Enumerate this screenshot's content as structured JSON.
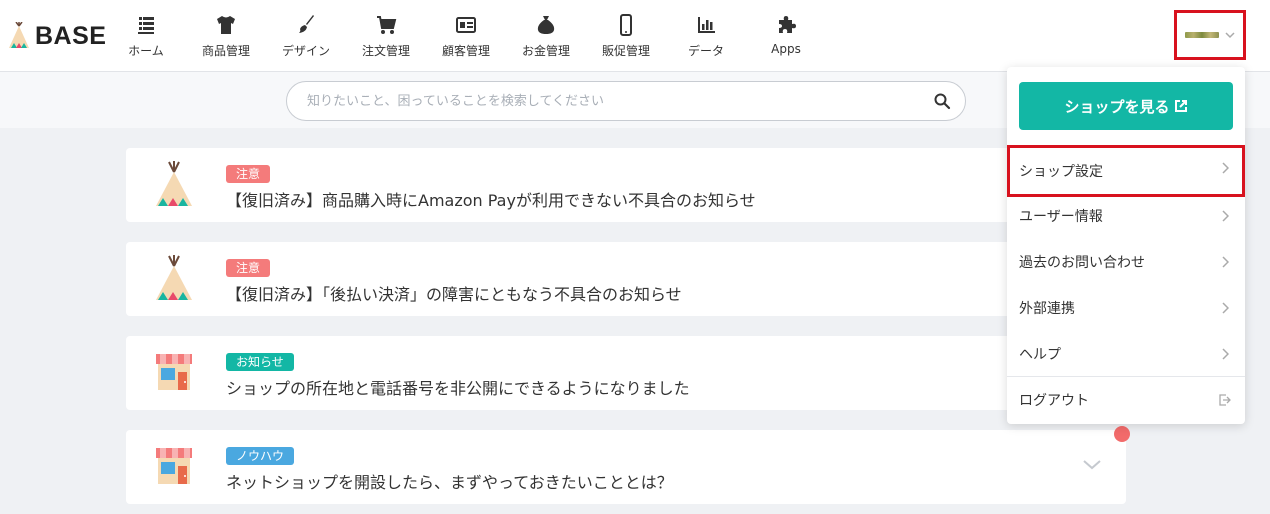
{
  "header": {
    "logo_text": "BASE",
    "nav": [
      {
        "label": "ホーム",
        "icon": "home-list-icon"
      },
      {
        "label": "商品管理",
        "icon": "tshirt-icon"
      },
      {
        "label": "デザイン",
        "icon": "paintbrush-icon"
      },
      {
        "label": "注文管理",
        "icon": "cart-icon"
      },
      {
        "label": "顧客管理",
        "icon": "id-card-icon"
      },
      {
        "label": "お金管理",
        "icon": "money-pouch-icon"
      },
      {
        "label": "販促管理",
        "icon": "smartphone-icon"
      },
      {
        "label": "データ",
        "icon": "bar-chart-icon"
      },
      {
        "label": "Apps",
        "icon": "puzzle-icon"
      }
    ]
  },
  "search": {
    "placeholder": "知りたいこと、困っていることを検索してください"
  },
  "notices": [
    {
      "badge": "注意",
      "badge_color": "#f47b7b",
      "title": "【復旧済み】商品購入時にAmazon Payが利用できない不具合のお知らせ",
      "icon": "tent-icon"
    },
    {
      "badge": "注意",
      "badge_color": "#f47b7b",
      "title": "【復旧済み】「後払い決済」の障害にともなう不具合のお知らせ",
      "icon": "tent-icon"
    },
    {
      "badge": "お知らせ",
      "badge_color": "#13b7a5",
      "title": "ショップの所在地と電話番号を非公開にできるようになりました",
      "icon": "shop-icon"
    },
    {
      "badge": "ノウハウ",
      "badge_color": "#4aa8e0",
      "title": "ネットショップを開設したら、まずやっておきたいこととは？",
      "icon": "shop-icon"
    }
  ],
  "dropdown": {
    "view_shop_label": "ショップを見る",
    "items": [
      {
        "label": "ショップ設定"
      },
      {
        "label": "ユーザー情報"
      },
      {
        "label": "過去のお問い合わせ"
      },
      {
        "label": "外部連携"
      },
      {
        "label": "ヘルプ"
      }
    ],
    "logout_label": "ログアウト"
  },
  "colors": {
    "accent": "#13b7a5",
    "highlight_border": "#d8121e",
    "notification_dot": "#f26b6b"
  }
}
